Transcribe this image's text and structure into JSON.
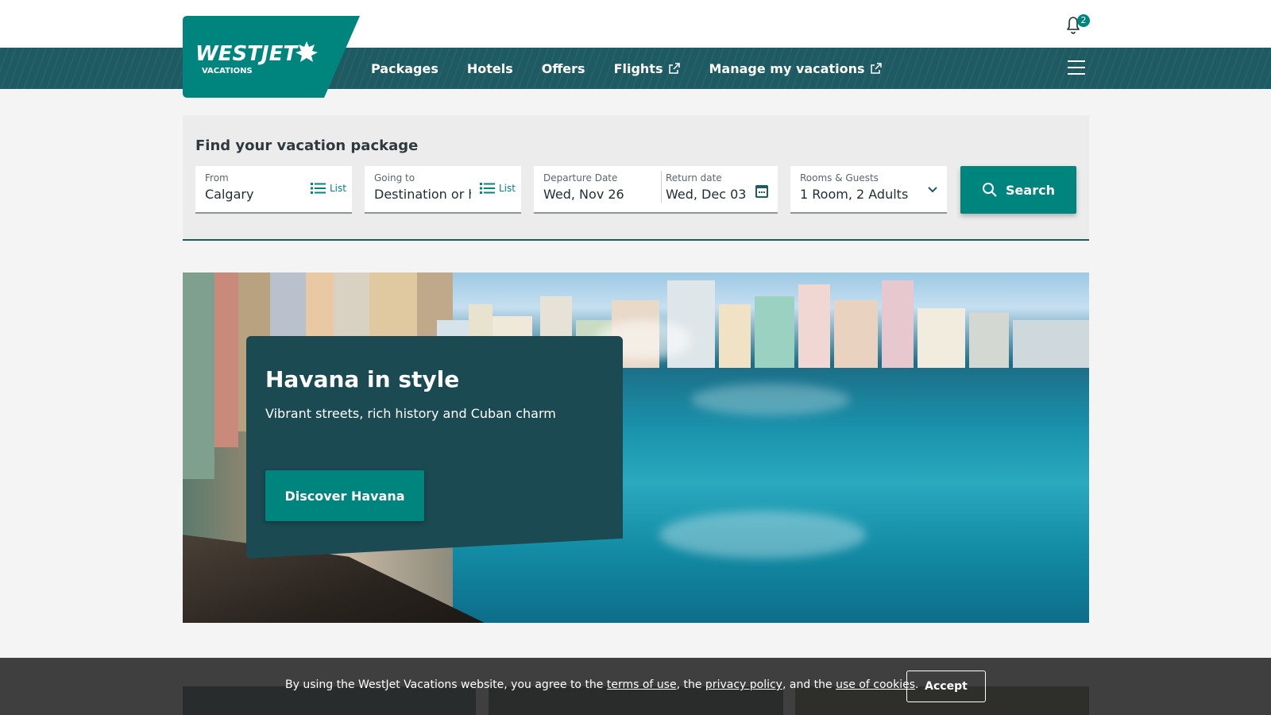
{
  "header": {
    "notification_count": "2",
    "logo_text_main": "WESTJET",
    "logo_text_sub": "VACATIONS",
    "brand_color": "#00857e",
    "nav_color": "#1e5a62"
  },
  "nav": {
    "items": [
      {
        "label": "Packages",
        "external": false
      },
      {
        "label": "Hotels",
        "external": false
      },
      {
        "label": "Offers",
        "external": false
      },
      {
        "label": "Flights",
        "external": true
      },
      {
        "label": "Manage my vacations",
        "external": true
      }
    ]
  },
  "search": {
    "title": "Find your vacation package",
    "from": {
      "label": "From",
      "value": "Calgary",
      "list_label": "List"
    },
    "going_to": {
      "label": "Going to",
      "placeholder": "Destination or h",
      "list_label": "List"
    },
    "departure": {
      "label": "Departure Date",
      "value": "Wed, Nov 26"
    },
    "return": {
      "label": "Return date",
      "value": "Wed, Dec 03"
    },
    "rooms": {
      "label": "Rooms & Guests",
      "value": "1 Room, 2 Adults"
    },
    "button_label": "Search"
  },
  "hero": {
    "title": "Havana in style",
    "subtitle": "Vibrant streets, rich history and Cuban charm",
    "button_label": "Discover Havana"
  },
  "cookie": {
    "text_1": "By using the WestJet Vacations website, you agree to the ",
    "link_terms": "terms of use",
    "text_2": ", the ",
    "link_privacy": "privacy policy",
    "text_3": ", and the ",
    "link_cookies": "use of cookies",
    "text_4": ".",
    "accept_label": "Accept"
  }
}
